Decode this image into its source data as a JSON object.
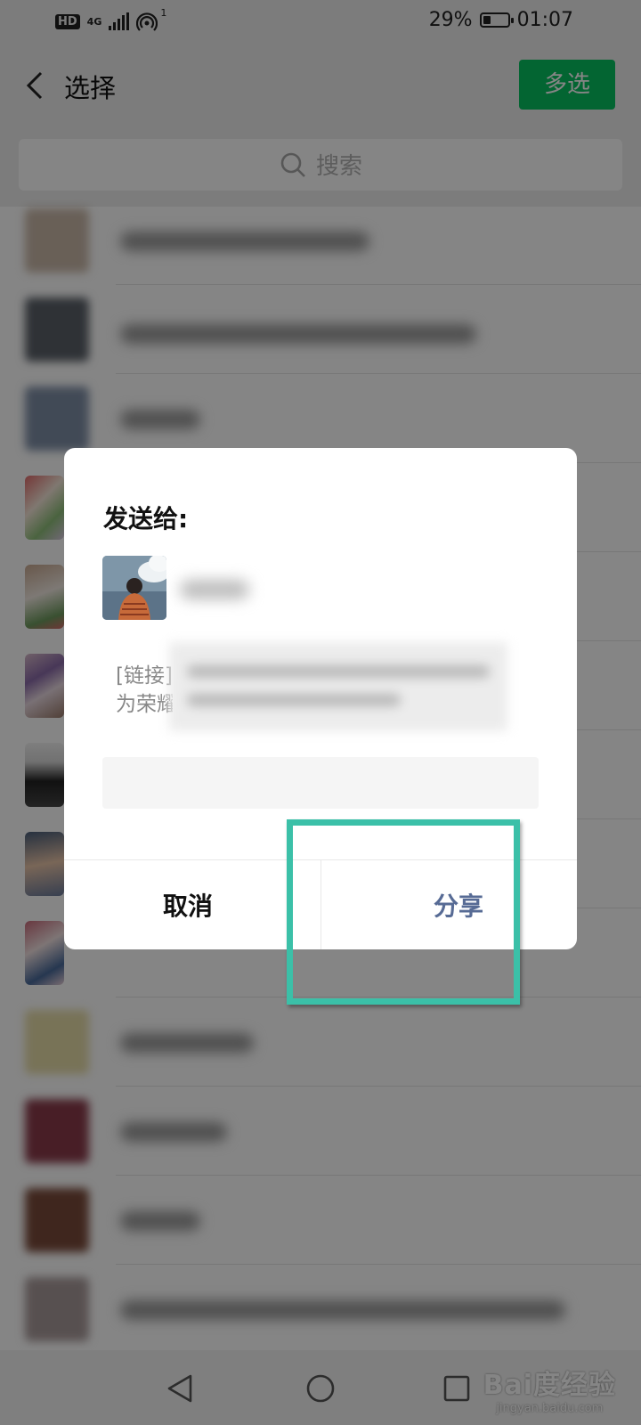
{
  "status_bar": {
    "hd": "HD",
    "network": "4G",
    "hotspot_count": "1",
    "battery_pct": "29%",
    "battery_level": 0.29,
    "time": "01:07"
  },
  "header": {
    "title": "选择",
    "multi_select_label": "多选",
    "accent": "#07c160"
  },
  "search": {
    "placeholder": "搜索"
  },
  "dialog": {
    "title": "发送给:",
    "link_preview": "[链接]\n为荣耀",
    "cancel_label": "取消",
    "share_label": "分享",
    "share_color": "#576b95"
  },
  "watermark": {
    "main": "Bai度经验",
    "sub": "jingyan.baidu.com"
  }
}
